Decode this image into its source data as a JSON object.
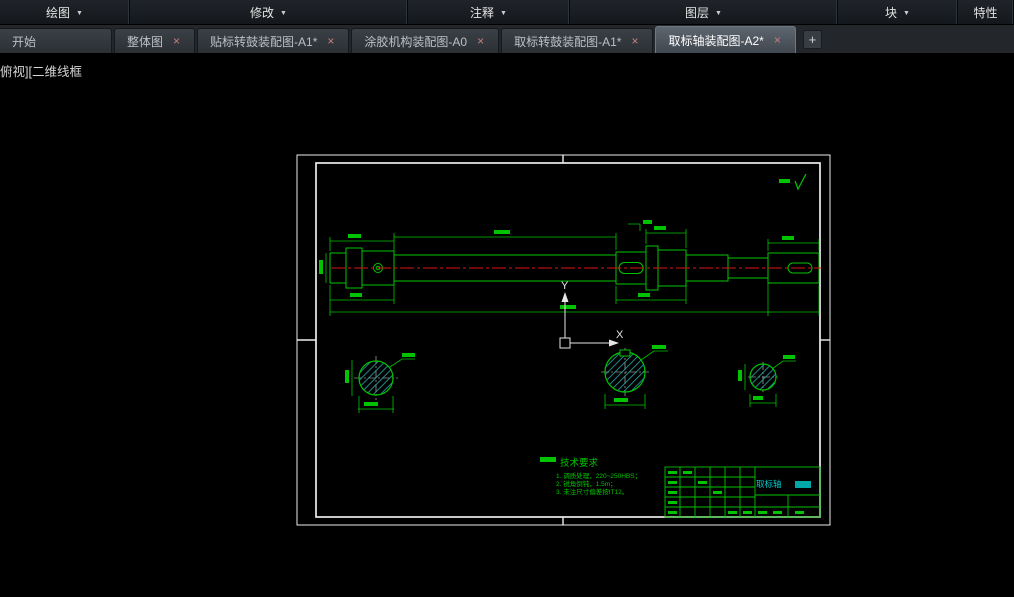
{
  "colors": {
    "cad_green": "#00c400",
    "centerline_red": "#dc1414",
    "hatch_teal": "#2aa0a0",
    "frame_white": "#ededed",
    "cyan_text": "#00c8c8",
    "canvas_black": "#000000"
  },
  "icons": {
    "caret_down": "▼",
    "close": "×",
    "new_tab": "+"
  },
  "menu_bar": {
    "items": [
      {
        "label": "绘图"
      },
      {
        "label": "修改"
      },
      {
        "label": "注释"
      },
      {
        "label": "图层"
      },
      {
        "label": "块"
      },
      {
        "label": "特性"
      }
    ]
  },
  "tab_bar": {
    "tabs": [
      {
        "label": "开始",
        "closable": false,
        "active": false
      },
      {
        "label": "整体图",
        "closable": true,
        "active": false
      },
      {
        "label": "贴标转鼓装配图-A1*",
        "closable": true,
        "active": false
      },
      {
        "label": "涂胶机构装配图-A0",
        "closable": true,
        "active": false
      },
      {
        "label": "取标转鼓装配图-A1*",
        "closable": true,
        "active": false
      },
      {
        "label": "取标轴装配图-A2*",
        "closable": true,
        "active": true
      }
    ]
  },
  "viewport": {
    "view_controls": "俯视][二维线框"
  },
  "drawing": {
    "ucs": {
      "x_label": "X",
      "y_label": "Y"
    },
    "tech_requirements": {
      "title": "技术要求",
      "items": [
        "1. 调质处理，220~250HBS；",
        "2. 锐角倒钝，1.5m；",
        "3. 未注尺寸偏差按IT12。"
      ]
    },
    "title_block": {
      "part_name": "取标轴"
    }
  }
}
